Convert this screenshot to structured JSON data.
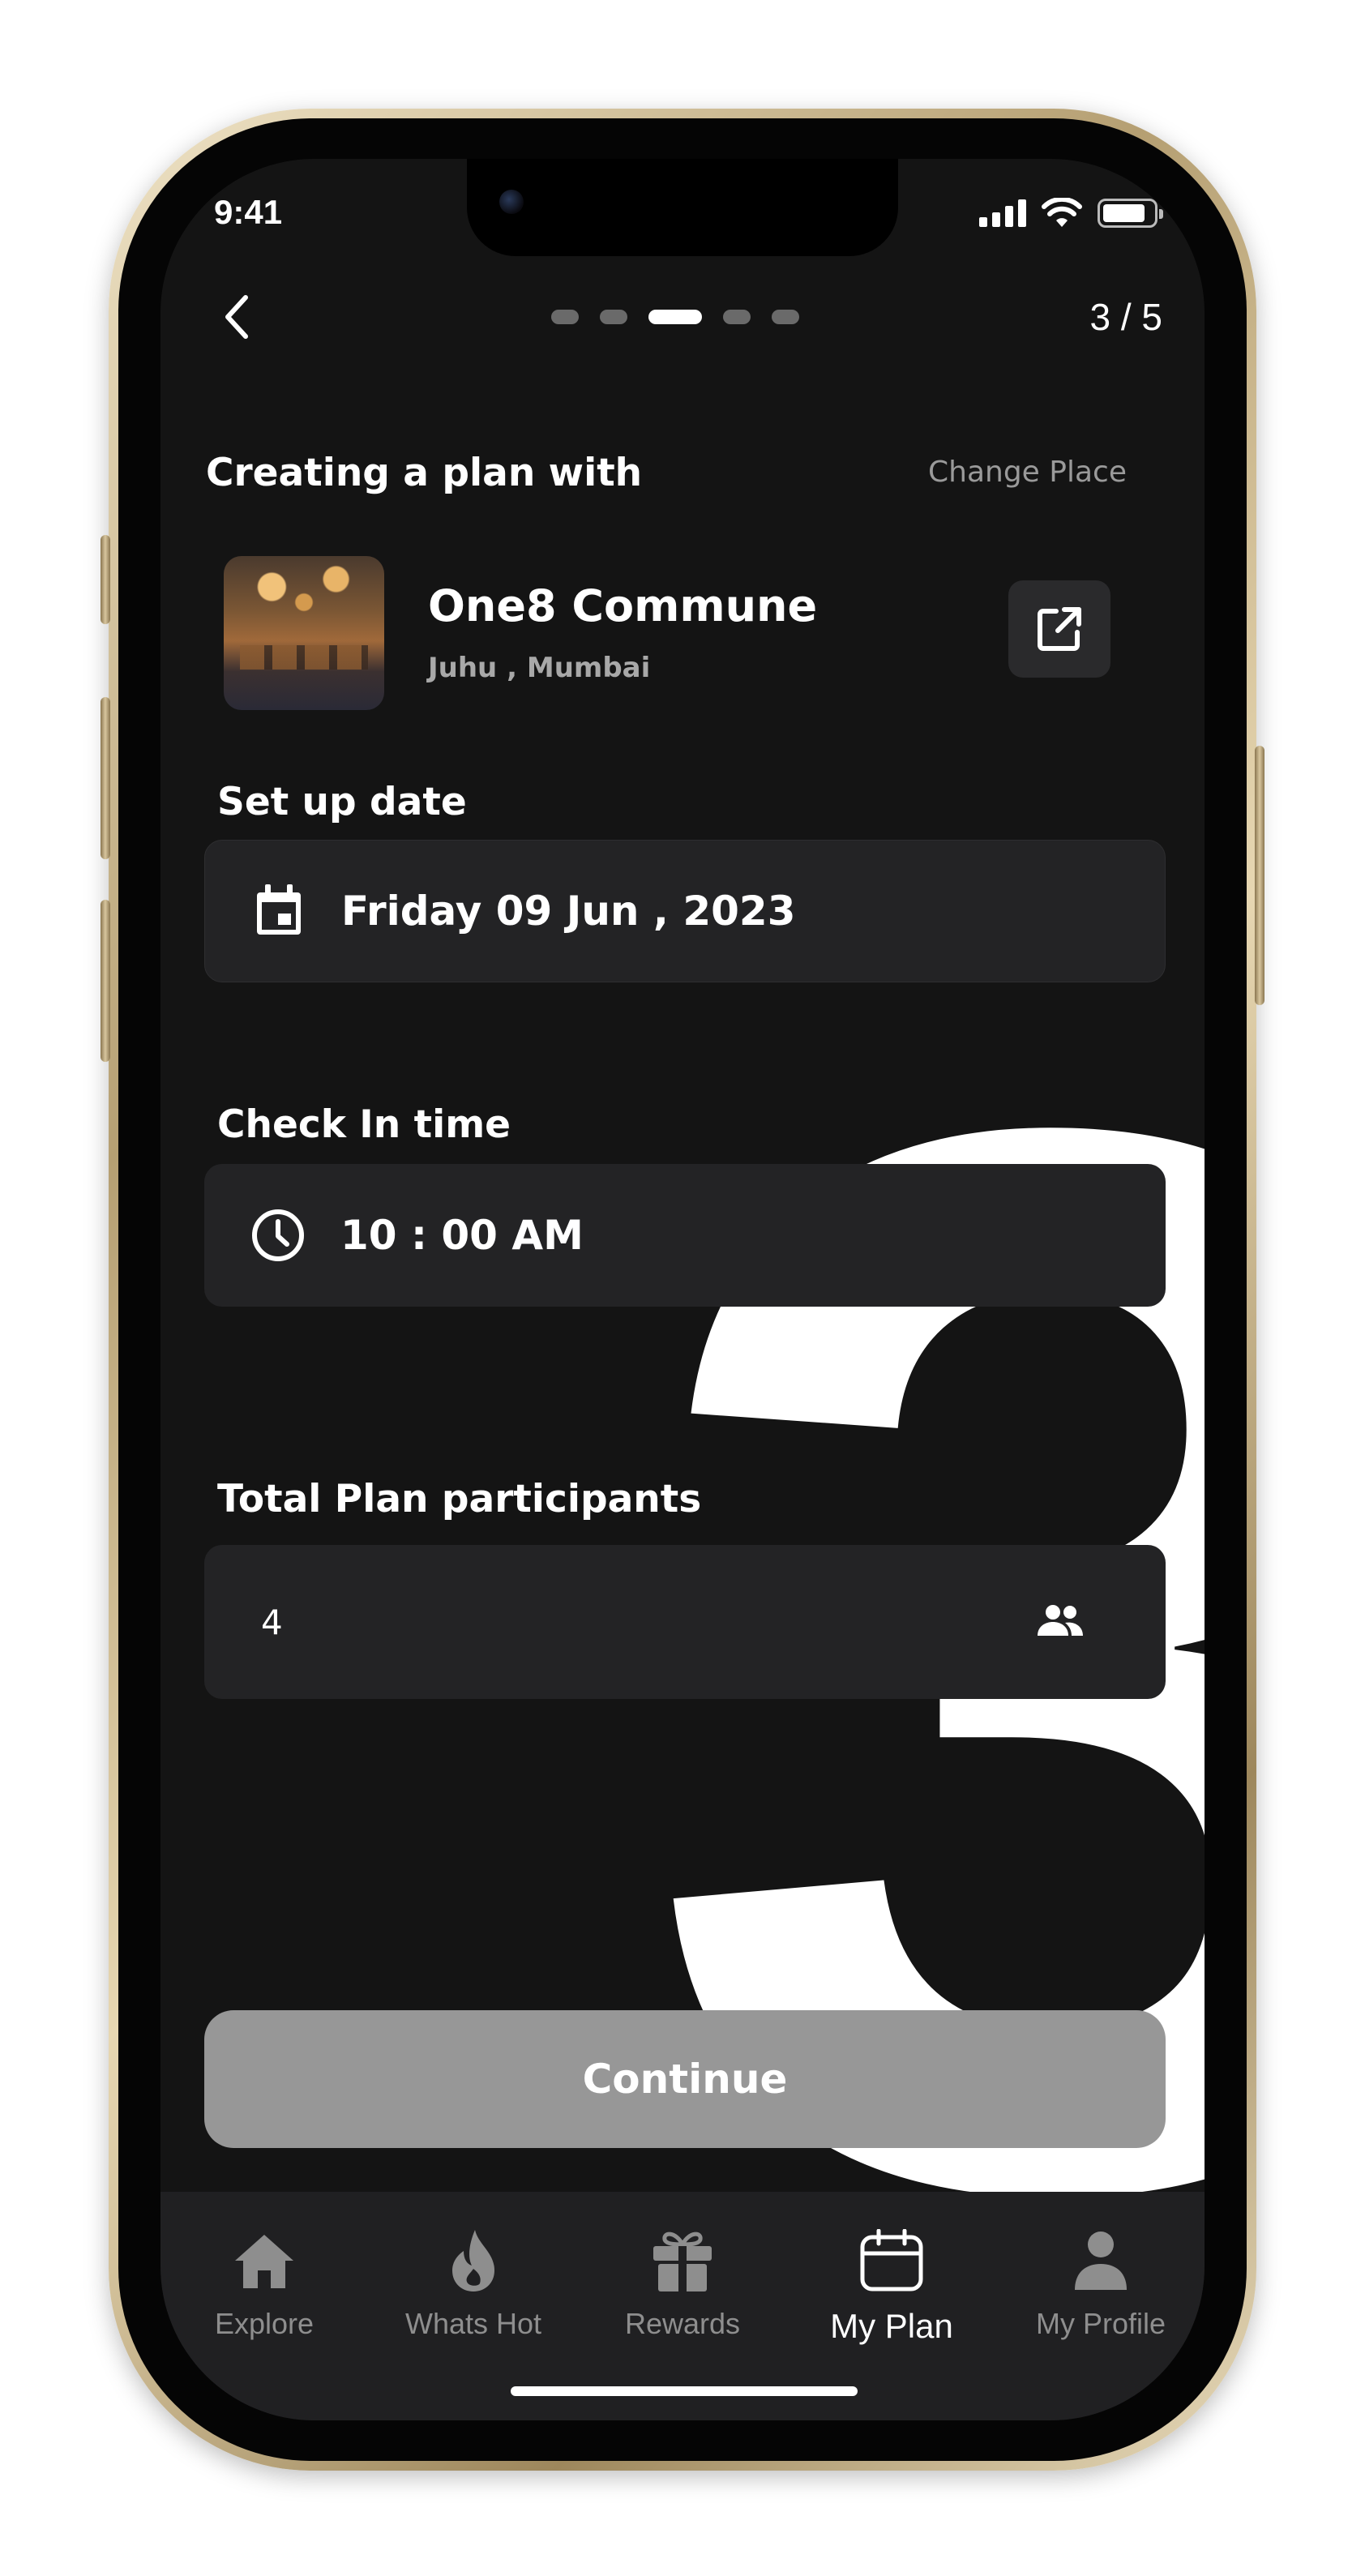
{
  "status_bar": {
    "time": "9:41"
  },
  "header": {
    "step_counter": "3 / 5",
    "steps_total": 5,
    "active_step": 3
  },
  "background_numeral": "3",
  "place": {
    "heading": "Creating a plan with",
    "change_label": "Change Place",
    "name": "One8 Commune",
    "location": "Juhu , Mumbai"
  },
  "date": {
    "label": "Set up date",
    "value": "Friday 09 Jun , 2023"
  },
  "time": {
    "label": "Check In time",
    "value": "10 : 00  AM"
  },
  "participants": {
    "label": "Total Plan participants",
    "value": "4"
  },
  "continue_label": "Continue",
  "tabs": [
    {
      "label": "Explore",
      "icon": "home-icon"
    },
    {
      "label": "Whats Hot",
      "icon": "flame-icon"
    },
    {
      "label": "Rewards",
      "icon": "gift-icon"
    },
    {
      "label": "My Plan",
      "icon": "calendar-icon",
      "active": true
    },
    {
      "label": "My Profile",
      "icon": "person-icon"
    }
  ],
  "colors": {
    "background": "#141414",
    "field": "#232325",
    "button_disabled": "#979797",
    "tabbar": "#202022"
  }
}
